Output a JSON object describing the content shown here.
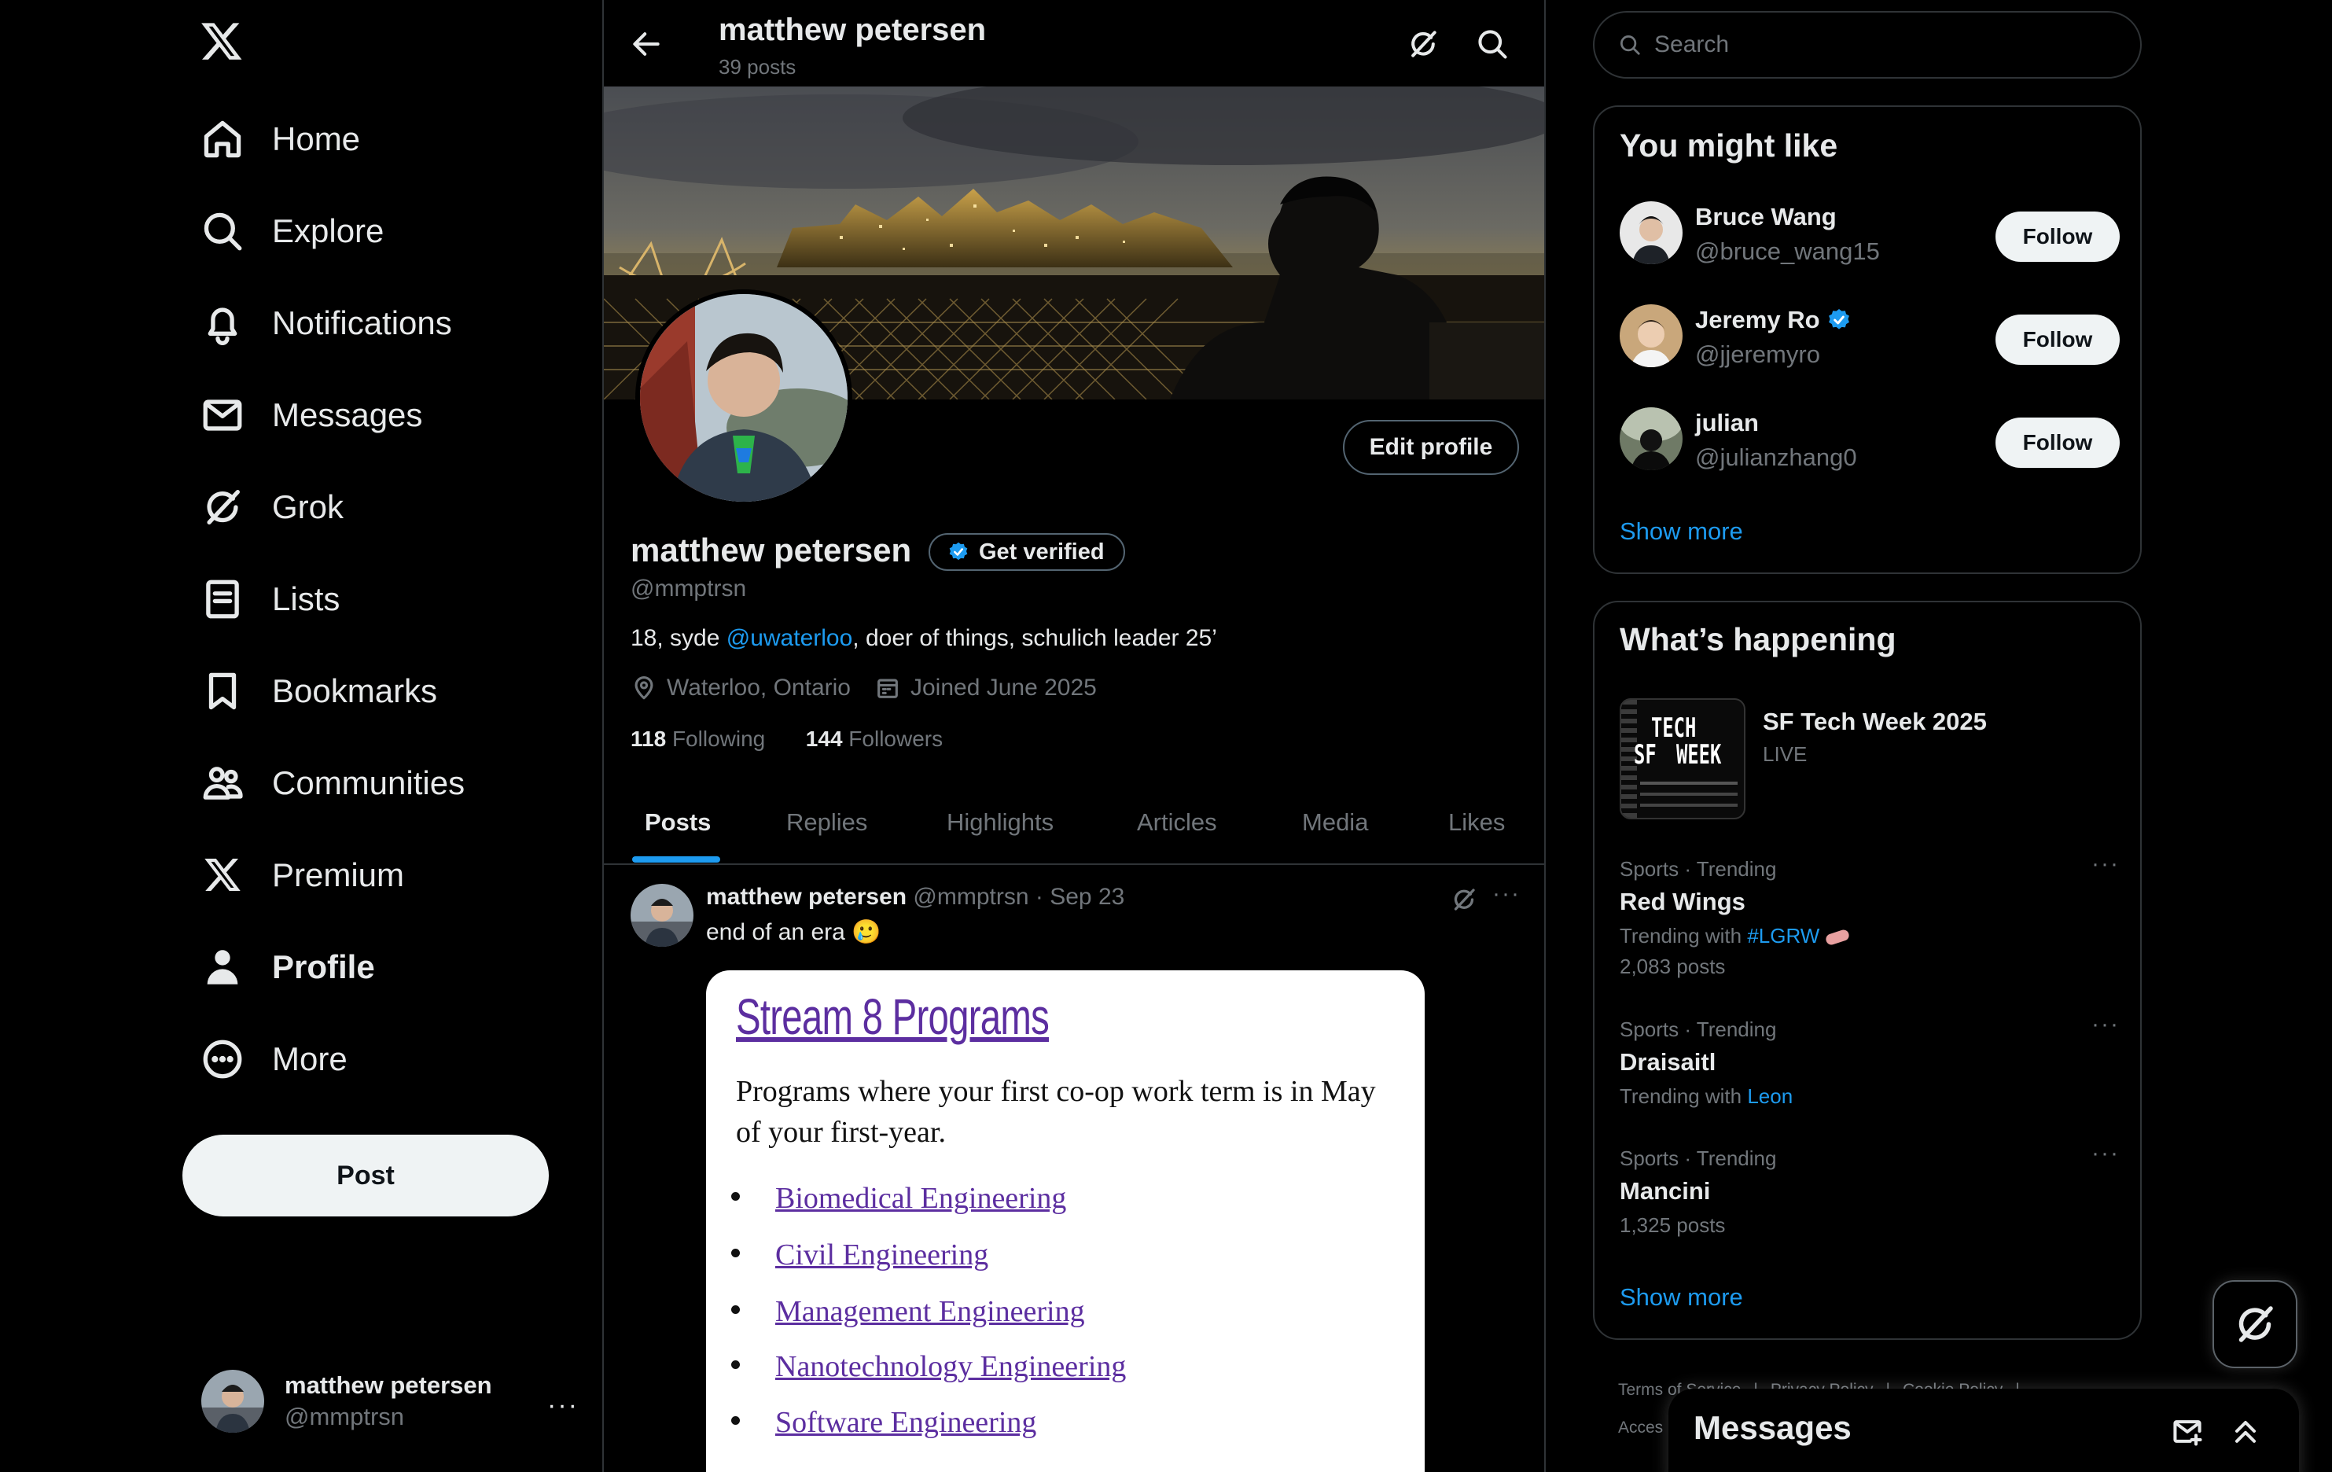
{
  "nav": {
    "items": [
      {
        "label": "Home"
      },
      {
        "label": "Explore"
      },
      {
        "label": "Notifications"
      },
      {
        "label": "Messages"
      },
      {
        "label": "Grok"
      },
      {
        "label": "Lists"
      },
      {
        "label": "Bookmarks"
      },
      {
        "label": "Communities"
      },
      {
        "label": "Premium"
      },
      {
        "label": "Profile"
      },
      {
        "label": "More"
      }
    ],
    "post_label": "Post",
    "account": {
      "name": "matthew petersen",
      "handle": "@mmptrsn"
    }
  },
  "header": {
    "title": "matthew petersen",
    "posts": "39 posts"
  },
  "profile": {
    "edit_label": "Edit profile",
    "name": "matthew petersen",
    "get_verified": "Get verified",
    "handle": "@mmptrsn",
    "bio_prefix": "18, syde ",
    "bio_link": "@uwaterloo",
    "bio_suffix": ", doer of things, schulich leader 25’",
    "location": "Waterloo, Ontario",
    "joined": "Joined June 2025",
    "following_count": "118",
    "following_label": " Following",
    "followers_count": "144",
    "followers_label": " Followers"
  },
  "tabs": [
    "Posts",
    "Replies",
    "Highlights",
    "Articles",
    "Media",
    "Likes"
  ],
  "tweet": {
    "name": "matthew petersen",
    "handle": "@mmptrsn",
    "sep": " · ",
    "date": "Sep 23",
    "text": "end of an era",
    "emoji": "🥲",
    "image": {
      "title": "Stream 8 Programs",
      "desc": "Programs where your first co-op work term is in May of your first-year.",
      "programs": [
        "Biomedical Engineering",
        "Civil Engineering",
        "Management Engineering",
        "Nanotechnology Engineering",
        "Software Engineering"
      ]
    }
  },
  "search": {
    "placeholder": "Search"
  },
  "suggestions": {
    "title": "You might like",
    "users": [
      {
        "name": "Bruce Wang",
        "handle": "@bruce_wang15",
        "button": "Follow"
      },
      {
        "name": "Jeremy Ro",
        "handle": "@jjeremyro",
        "button": "Follow"
      },
      {
        "name": "julian",
        "handle": "@julianzhang0",
        "button": "Follow"
      }
    ],
    "show_more": "Show more"
  },
  "happening": {
    "title": "What’s happening",
    "event": {
      "title": "SF Tech Week 2025",
      "status": "LIVE",
      "thumb_line1": "TECH",
      "thumb_line2": "SF",
      "thumb_line3": "WEEK"
    },
    "trends": [
      {
        "category": "Sports · Trending",
        "title": "Red Wings",
        "sub_prefix": "Trending with ",
        "sub_link": "#LGRW",
        "posts": "2,083 posts"
      },
      {
        "category": "Sports · Trending",
        "title": "Draisaitl",
        "sub_prefix": "Trending with ",
        "sub_link": "Leon"
      },
      {
        "category": "Sports · Trending",
        "title": "Mancini",
        "posts": "1,325 posts"
      }
    ],
    "show_more": "Show more"
  },
  "footer": {
    "links": [
      "Terms of Service",
      "|",
      "Privacy Policy",
      "|",
      "Cookie Policy",
      "|"
    ],
    "line2": "Acces"
  },
  "messages_drawer": {
    "title": "Messages"
  },
  "colors": {
    "accent": "#1d9bf0",
    "background": "#000000",
    "border": "#2f3336",
    "muted": "#71767b"
  }
}
